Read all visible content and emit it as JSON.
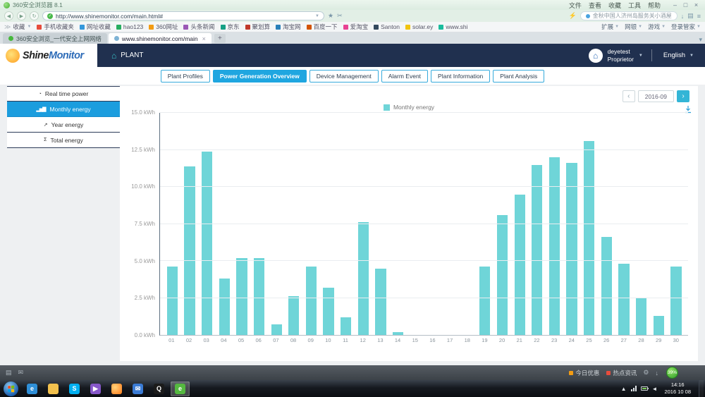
{
  "browser": {
    "window_title": "360安全浏览器 8.1",
    "menu_items": [
      "文件",
      "查看",
      "收藏",
      "工具",
      "帮助"
    ],
    "url": "http://www.shinemonitor.com/main.html#",
    "promo_text": "金秋中国人济州岛服务关小酒屋",
    "bookmarks_label": "收藏",
    "bookmarks": [
      "手机收藏夹",
      "网址收藏",
      "hao123",
      "360网址",
      "头条新闻",
      "京东",
      "聚划算",
      "淘宝网",
      "百度一下",
      "爱淘宝",
      "Santon",
      "solar.ey",
      "www.shi"
    ],
    "bookmark_tools": [
      "扩展",
      "网银",
      "游戏",
      "登录管家"
    ],
    "tabs": [
      {
        "title": "360安全浏览_一代安全上网网络",
        "active": false
      },
      {
        "title": "www.shinemonitor.com/main",
        "active": true
      }
    ]
  },
  "app": {
    "logo_shine": "Shine",
    "logo_monitor": "Monitor",
    "nav_plant": "PLANT",
    "user_name": "deyetest",
    "user_role": "Proprietor",
    "language": "English",
    "date_selector": "2016-09",
    "tabs": [
      {
        "label": "Plant Profiles",
        "active": false
      },
      {
        "label": "Power Generation Overview",
        "active": true
      },
      {
        "label": "Device Management",
        "active": false
      },
      {
        "label": "Alarm Event",
        "active": false
      },
      {
        "label": "Plant Information",
        "active": false
      },
      {
        "label": "Plant Analysis",
        "active": false
      }
    ],
    "sidebar": [
      {
        "label": "Real time power",
        "icon": "gauge-icon",
        "active": false
      },
      {
        "label": "Monthly energy",
        "icon": "bar-chart-icon",
        "active": true
      },
      {
        "label": "Year energy",
        "icon": "line-chart-icon",
        "active": false
      },
      {
        "label": "Total energy",
        "icon": "sigma-icon",
        "active": false
      }
    ]
  },
  "chart_data": {
    "type": "bar",
    "legend_label": "Monthly energy",
    "legend_position": "top",
    "grid": true,
    "unit": "kWh",
    "categories": [
      "01",
      "02",
      "03",
      "04",
      "05",
      "06",
      "07",
      "08",
      "09",
      "10",
      "11",
      "12",
      "13",
      "14",
      "15",
      "16",
      "17",
      "18",
      "19",
      "20",
      "21",
      "22",
      "23",
      "24",
      "25",
      "26",
      "27",
      "28",
      "29",
      "30"
    ],
    "values": [
      4.6,
      11.4,
      12.4,
      3.8,
      5.2,
      5.2,
      0.7,
      2.6,
      4.6,
      3.2,
      1.2,
      7.6,
      4.5,
      0.2,
      0,
      0,
      0,
      0,
      4.6,
      8.1,
      9.5,
      11.5,
      12.0,
      11.6,
      13.1,
      6.6,
      4.8,
      2.5,
      1.3,
      4.6
    ],
    "ylim": [
      0,
      15
    ],
    "ytick_values": [
      0,
      2.5,
      5,
      7.5,
      10,
      12.5,
      15
    ],
    "ytick_labels": [
      "0.0 kWh",
      "2.5 kWh",
      "5.0 kWh",
      "7.5 kWh",
      "10.0 kWh",
      "12.5 kWh",
      "15.0 kWh"
    ],
    "bar_color": "#6FD5D8"
  },
  "statusbar": {
    "right_items": [
      {
        "label": "今日优惠",
        "color": "#f39c12"
      },
      {
        "label": "热点资讯",
        "color": "#e74c3c"
      }
    ],
    "speedball": "39%"
  },
  "taskbar": {
    "tray_time": "14:16",
    "tray_date": "2016 10 08",
    "icons": [
      {
        "name": "ie-browser-icon",
        "active": false
      },
      {
        "name": "folder-icon",
        "active": false
      },
      {
        "name": "skype-icon",
        "active": false
      },
      {
        "name": "media-player-icon",
        "active": false
      },
      {
        "name": "firefox-icon",
        "active": false
      },
      {
        "name": "mail-icon",
        "active": false
      },
      {
        "name": "qq-icon",
        "active": false
      },
      {
        "name": "360-browser-icon",
        "active": true
      }
    ]
  }
}
